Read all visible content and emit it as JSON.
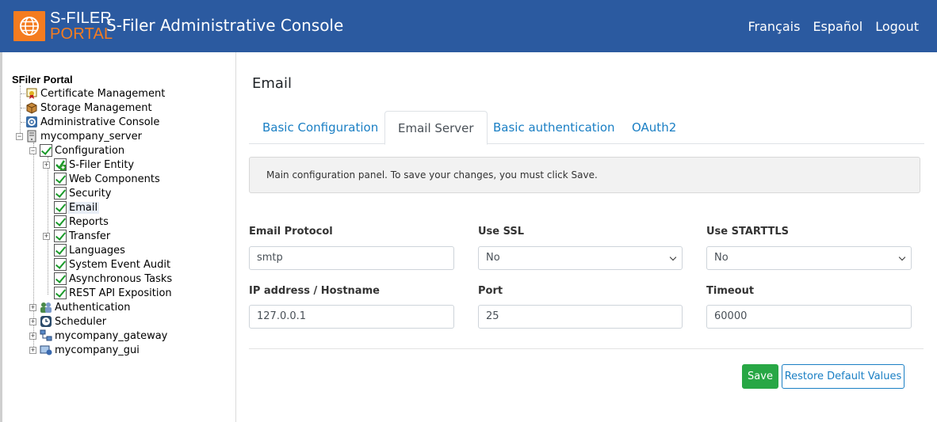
{
  "header": {
    "logo_line1": "S-FILER",
    "logo_line2": "PORTAL",
    "title": "S-Filer Administrative Console",
    "links": [
      "Français",
      "Español",
      "Logout"
    ],
    "bg_color": "#2b5aa0",
    "accent_color": "#f47c20"
  },
  "sidebar": {
    "root": "SFiler Portal",
    "items": [
      {
        "label": "Certificate Management",
        "icon": "certificate-icon"
      },
      {
        "label": "Storage Management",
        "icon": "storage-box-icon"
      },
      {
        "label": "Administrative Console",
        "icon": "gear-icon"
      },
      {
        "label": "mycompany_server",
        "icon": "server-icon"
      },
      {
        "label": "Configuration",
        "icon": "check-icon"
      },
      {
        "label": "S-Filer Entity",
        "icon": "check-plus-icon"
      },
      {
        "label": "Web Components",
        "icon": "check-icon"
      },
      {
        "label": "Security",
        "icon": "check-icon"
      },
      {
        "label": "Email",
        "icon": "check-icon",
        "selected": true
      },
      {
        "label": "Reports",
        "icon": "check-icon"
      },
      {
        "label": "Transfer",
        "icon": "check-icon"
      },
      {
        "label": "Languages",
        "icon": "check-icon"
      },
      {
        "label": "System Event Audit",
        "icon": "check-icon"
      },
      {
        "label": "Asynchronous Tasks",
        "icon": "check-icon"
      },
      {
        "label": "REST API Exposition",
        "icon": "check-icon"
      },
      {
        "label": "Authentication",
        "icon": "users-icon"
      },
      {
        "label": "Scheduler",
        "icon": "clock-icon"
      },
      {
        "label": "mycompany_gateway",
        "icon": "network-icon"
      },
      {
        "label": "mycompany_gui",
        "icon": "monitor-icon"
      }
    ]
  },
  "main": {
    "title": "Email",
    "tabs": [
      {
        "label": "Basic Configuration",
        "active": false
      },
      {
        "label": "Email Server",
        "active": true
      },
      {
        "label": "Basic authentication",
        "active": false
      },
      {
        "label": "OAuth2",
        "active": false
      }
    ],
    "info": "Main configuration panel. To save your changes, you must click Save.",
    "fields": {
      "protocol": {
        "label": "Email Protocol",
        "value": "smtp"
      },
      "ssl": {
        "label": "Use SSL",
        "value": "No"
      },
      "starttls": {
        "label": "Use STARTTLS",
        "value": "No"
      },
      "host": {
        "label": "IP address / Hostname",
        "value": "127.0.0.1"
      },
      "port": {
        "label": "Port",
        "value": "25"
      },
      "timeout": {
        "label": "Timeout",
        "value": "60000"
      }
    },
    "buttons": {
      "save": "Save",
      "restore": "Restore Default Values"
    }
  }
}
